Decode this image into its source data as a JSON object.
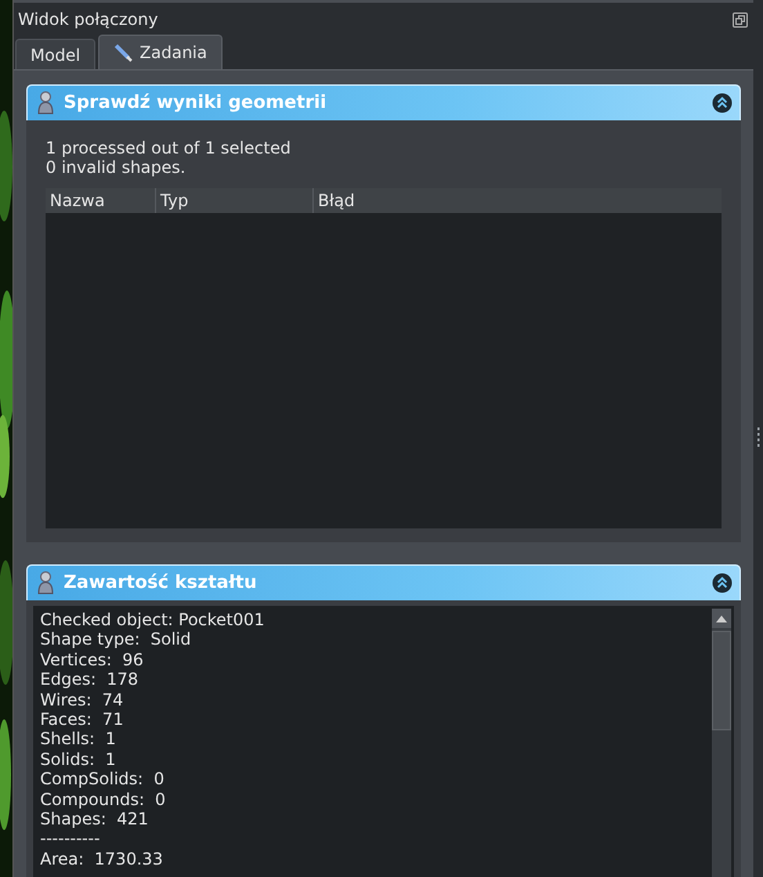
{
  "window": {
    "title": "Widok połączony"
  },
  "tabs": [
    {
      "label": "Model",
      "selected": false,
      "icon": false
    },
    {
      "label": "Zadania",
      "selected": true,
      "icon": true
    }
  ],
  "panels": [
    {
      "title": "Sprawdź wyniki geometrii",
      "kind": "results",
      "summary": [
        "1 processed out of 1 selected",
        "0 invalid shapes."
      ],
      "table": {
        "columns": [
          "Nazwa",
          "Typ",
          "Błąd"
        ]
      }
    },
    {
      "title": "Zawartość kształtu",
      "kind": "text",
      "lines": [
        "Checked object: Pocket001",
        "Shape type:  Solid",
        "Vertices:  96",
        "Edges:  178",
        "Wires:  74",
        "Faces:  71",
        "Shells:  1",
        "Solids:  1",
        "CompSolids:  0",
        "Compounds:  0",
        "Shapes:  421",
        "----------",
        "Area:  1730.33"
      ]
    }
  ]
}
